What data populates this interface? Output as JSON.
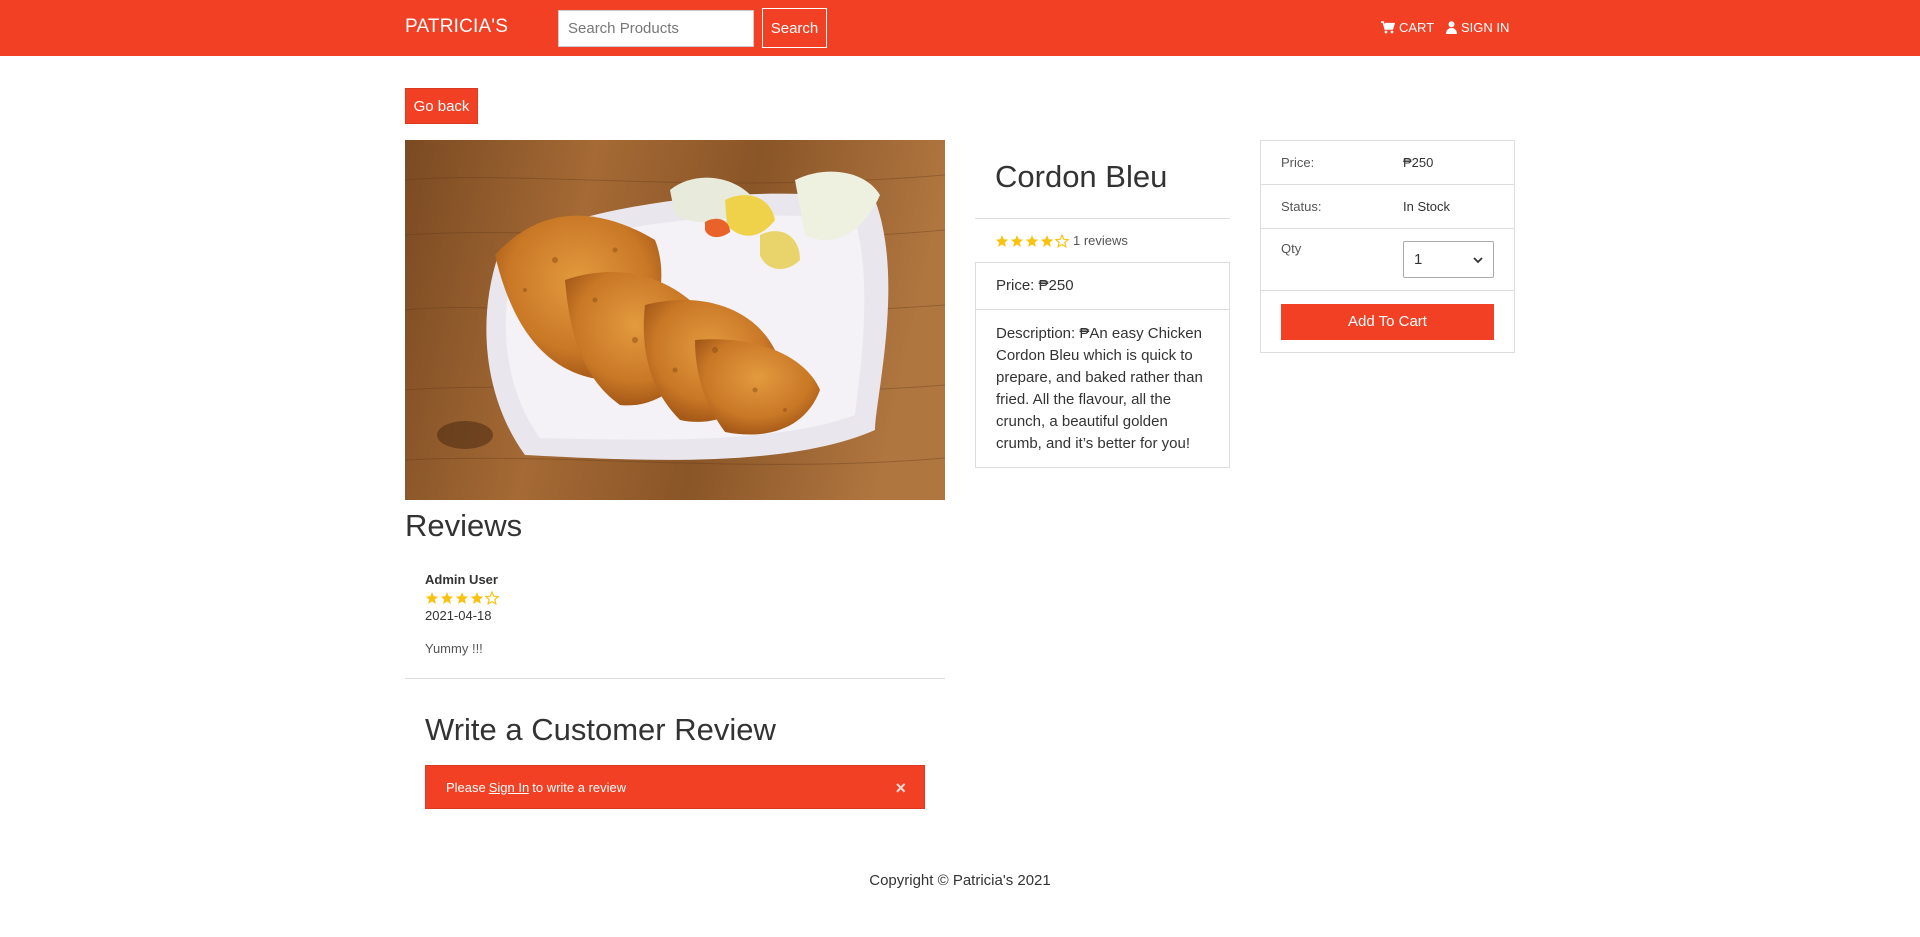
{
  "nav": {
    "brand": "PATRICIA'S",
    "search_placeholder": "Search Products",
    "search_button": "Search",
    "cart_label": "CART",
    "signin_label": "SIGN IN"
  },
  "back_button": "Go back",
  "product": {
    "name": "Cordon Bleu",
    "rating": 4,
    "reviews_text": "1 reviews",
    "price_line": "Price: ₱250",
    "description": "Description: ₱An easy Chicken Cordon Bleu which is quick to prepare, and baked rather than fried. All the flavour, all the crunch, a beautiful golden crumb, and it’s better for you!"
  },
  "cart": {
    "price_label": "Price:",
    "price_value": "₱250",
    "status_label": "Status:",
    "status_value": "In Stock",
    "qty_label": "Qty",
    "qty_value": "1",
    "add_button": "Add To Cart"
  },
  "reviews": {
    "title": "Reviews",
    "items": [
      {
        "name": "Admin User",
        "rating": 4,
        "date": "2021-04-18",
        "comment": "Yummy !!!"
      }
    ]
  },
  "write_review": {
    "title": "Write a Customer Review",
    "alert_prefix": "Please",
    "alert_link": "Sign In",
    "alert_suffix": "to write a review",
    "alert_close": "×"
  },
  "footer": "Copyright © Patricia's 2021",
  "colors": {
    "brand": "#f24024",
    "star": "#f8c20f"
  }
}
